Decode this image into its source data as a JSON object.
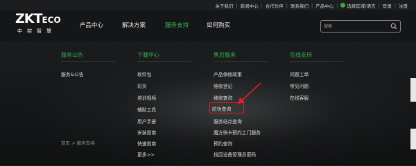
{
  "topbar": {
    "links": [
      "关于我们",
      "新闻中心",
      "合作伙伴",
      "联系我们",
      "产品中心"
    ],
    "region": "选择区域/语言",
    "login": "登录",
    "register": "注册"
  },
  "logo": {
    "main": "ZKT",
    "suffix": "ECO",
    "cn": "中控智慧"
  },
  "nav": {
    "items": [
      "产品中心",
      "解决方案",
      "服务支持",
      "如何购买"
    ],
    "active_index": 2
  },
  "search": {
    "placeholder": "搜索"
  },
  "menu": {
    "columns": [
      {
        "title": "服务公告",
        "items": [
          "服务&公告"
        ]
      },
      {
        "title": "下载中心",
        "items": [
          "软件包",
          "彩页",
          "培训视频",
          "辅助工具",
          "用户手册",
          "安装指南",
          "快速指南",
          "更多>>"
        ]
      },
      {
        "title": "售后服务",
        "items": [
          "产品保修政策",
          "维修登记",
          "维修查询",
          "防伪查询",
          "服务站点查询",
          "魔方快卡预约上门服务",
          "预约查询",
          "找回设备管理员密码"
        ]
      },
      {
        "title": "在线支持",
        "items": [
          "问题工单",
          "常见问题",
          "在线客服"
        ]
      }
    ]
  },
  "breadcrumb": "首页 > 服务支持",
  "colors": {
    "accent": "#39b54a",
    "highlight": "#e02020"
  }
}
